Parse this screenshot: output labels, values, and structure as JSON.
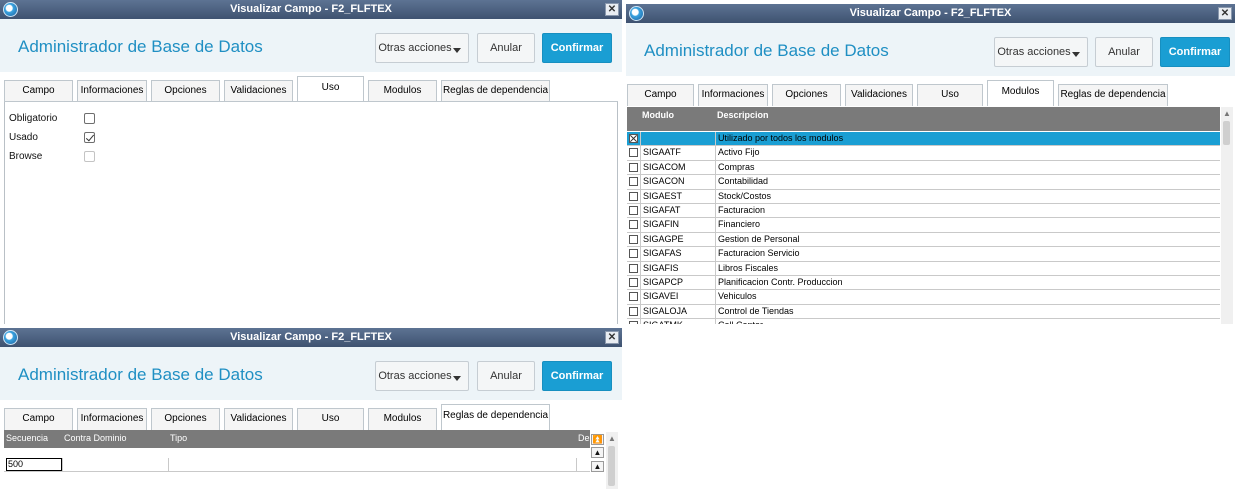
{
  "window_title": "Visualizar Campo - F2_FLFTEX",
  "app_title": "Administrador de Base de Datos",
  "actions": {
    "otras": "Otras acciones",
    "anular": "Anular",
    "confirmar": "Confirmar"
  },
  "close_glyph": "✕",
  "tabs": [
    "Campo",
    "Informaciones",
    "Opciones",
    "Validaciones",
    "Uso",
    "Modulos",
    "Reglas de dependencia"
  ],
  "uso": {
    "fields": [
      {
        "label": "Obligatorio",
        "checked": false,
        "enabled": true
      },
      {
        "label": "Usado",
        "checked": true,
        "enabled": true
      },
      {
        "label": "Browse",
        "checked": false,
        "enabled": false
      }
    ]
  },
  "modulos": {
    "columns": [
      "Modulo",
      "Descripcion"
    ],
    "rows": [
      {
        "modulo": "",
        "descripcion": "Utilizado por todos los modulos",
        "checked": true,
        "selected": true
      },
      {
        "modulo": "SIGAATF",
        "descripcion": "Activo Fijo"
      },
      {
        "modulo": "SIGACOM",
        "descripcion": "Compras"
      },
      {
        "modulo": "SIGACON",
        "descripcion": "Contabilidad"
      },
      {
        "modulo": "SIGAEST",
        "descripcion": "Stock/Costos"
      },
      {
        "modulo": "SIGAFAT",
        "descripcion": "Facturacion"
      },
      {
        "modulo": "SIGAFIN",
        "descripcion": "Financiero"
      },
      {
        "modulo": "SIGAGPE",
        "descripcion": "Gestion de Personal"
      },
      {
        "modulo": "SIGAFAS",
        "descripcion": "Facturacion Servicio"
      },
      {
        "modulo": "SIGAFIS",
        "descripcion": "Libros Fiscales"
      },
      {
        "modulo": "SIGAPCP",
        "descripcion": "Planificacion Contr. Produccion"
      },
      {
        "modulo": "SIGAVEI",
        "descripcion": "Vehiculos"
      },
      {
        "modulo": "SIGALOJA",
        "descripcion": "Control de Tiendas"
      },
      {
        "modulo": "SIGATMK",
        "descripcion": "Call Center"
      }
    ]
  },
  "reglas": {
    "columns": [
      "Secuencia",
      "Contra Dominio",
      "Tipo",
      "De"
    ],
    "rows": [
      {
        "secuencia": "500",
        "contra_dominio": "",
        "tipo": ""
      }
    ]
  },
  "colors": {
    "accent": "#1a9ed3",
    "titlebar": "#4a5f7e",
    "header_bg": "#edf4f8",
    "grid_header": "#7a7a7a"
  }
}
